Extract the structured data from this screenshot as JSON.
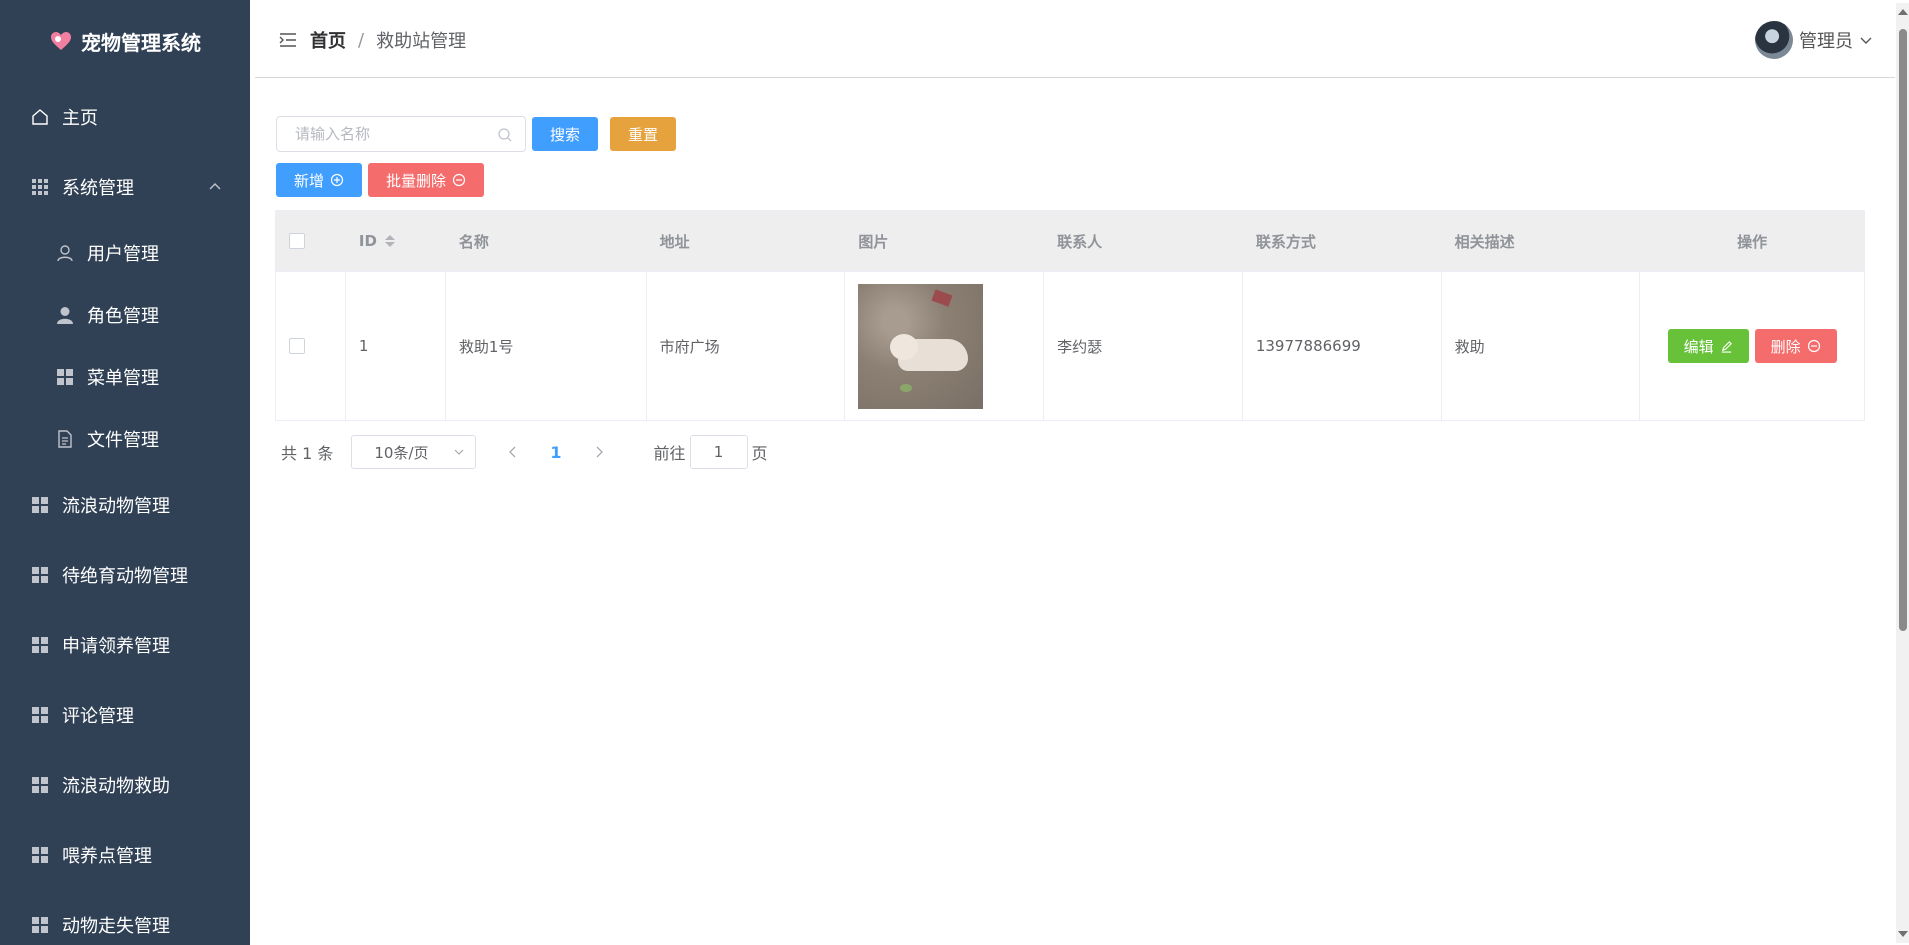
{
  "app": {
    "title": "宠物管理系统"
  },
  "sidebar": {
    "items": [
      {
        "label": "主页",
        "icon": "home-icon"
      },
      {
        "label": "系统管理",
        "icon": "grid-icon",
        "expanded": true,
        "children": [
          {
            "label": "用户管理",
            "icon": "user-icon"
          },
          {
            "label": "角色管理",
            "icon": "user-filled-icon"
          },
          {
            "label": "菜单管理",
            "icon": "menu-grid-icon"
          },
          {
            "label": "文件管理",
            "icon": "document-icon"
          }
        ]
      },
      {
        "label": "流浪动物管理",
        "icon": "grid-icon"
      },
      {
        "label": "待绝育动物管理",
        "icon": "grid-icon"
      },
      {
        "label": "申请领养管理",
        "icon": "grid-icon"
      },
      {
        "label": "评论管理",
        "icon": "grid-icon"
      },
      {
        "label": "流浪动物救助",
        "icon": "grid-icon"
      },
      {
        "label": "喂养点管理",
        "icon": "grid-icon"
      },
      {
        "label": "动物走失管理",
        "icon": "grid-icon"
      }
    ]
  },
  "header": {
    "breadcrumb": {
      "home": "首页",
      "separator": "/",
      "current": "救助站管理"
    },
    "user": "管理员"
  },
  "search": {
    "placeholder": "请输入名称",
    "value": "",
    "search_label": "搜索",
    "reset_label": "重置"
  },
  "actions": {
    "add_label": "新增",
    "batch_delete_label": "批量删除"
  },
  "table": {
    "columns": [
      "ID",
      "名称",
      "地址",
      "图片",
      "联系人",
      "联系方式",
      "相关描述",
      "操作"
    ],
    "rows": [
      {
        "id": "1",
        "name": "救助1号",
        "address": "市府广场",
        "contact": "李约瑟",
        "phone": "13977886699",
        "desc": "救助",
        "edit_label": "编辑",
        "delete_label": "删除"
      }
    ]
  },
  "pager": {
    "total": "共 1 条",
    "page_size": "10条/页",
    "current_page": "1",
    "goto_prefix": "前往",
    "goto_value": "1",
    "goto_suffix": "页"
  },
  "colors": {
    "sidebar_bg": "#304156",
    "primary": "#409eff",
    "warning": "#e6a23c",
    "danger": "#f56c6c",
    "success": "#67c23a"
  }
}
